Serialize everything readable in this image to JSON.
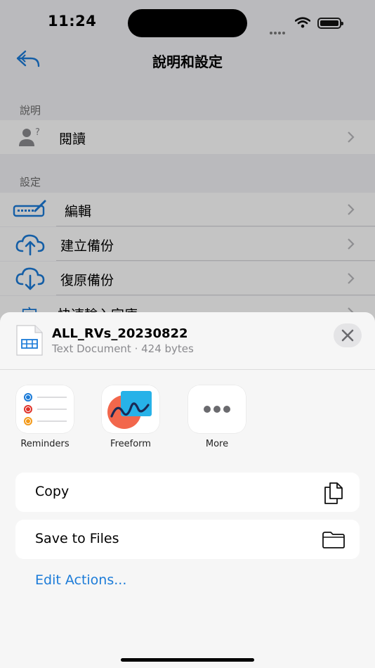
{
  "status_bar": {
    "time": "11:24"
  },
  "nav": {
    "title": "說明和設定"
  },
  "sections": [
    {
      "header": "說明",
      "rows": [
        {
          "icon": "person-question-icon",
          "label": "閱讀"
        }
      ]
    },
    {
      "header": "設定",
      "rows": [
        {
          "icon": "keyboard-pen-icon",
          "label": "編輯"
        },
        {
          "icon": "cloud-upload-icon",
          "label": "建立備份"
        },
        {
          "icon": "cloud-download-icon",
          "label": "復原備份"
        },
        {
          "icon": "character-icon",
          "label": "快速輸入字庫"
        }
      ]
    }
  ],
  "share_sheet": {
    "file_name": "ALL_RVs_20230822",
    "file_meta": "Text Document · 424 bytes",
    "apps": [
      {
        "label": "Reminders",
        "icon": "reminders-icon"
      },
      {
        "label": "Freeform",
        "icon": "freeform-icon"
      },
      {
        "label": "More",
        "icon": "more-icon"
      }
    ],
    "actions": [
      {
        "label": "Copy",
        "icon": "copy-icon"
      },
      {
        "label": "Save to Files",
        "icon": "folder-icon"
      }
    ],
    "edit_actions": "Edit Actions..."
  },
  "colors": {
    "accent": "#1b7bd8",
    "sheet_bg": "#f6f6f6",
    "group_bg": "#f2f2f6"
  }
}
